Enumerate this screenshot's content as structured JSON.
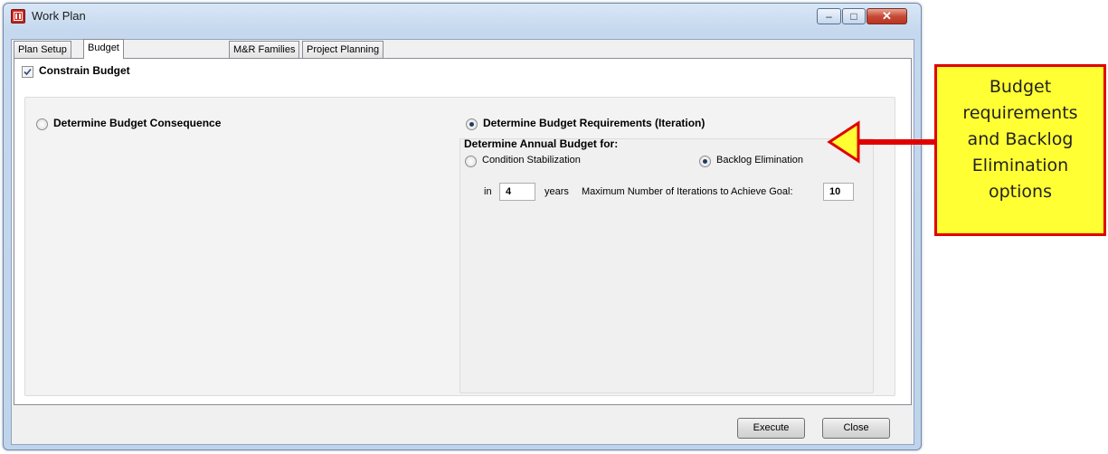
{
  "window": {
    "title": "Work Plan",
    "controls": {
      "minimize": "–",
      "maximize": "□",
      "close": "✕"
    }
  },
  "tabs": [
    {
      "label": "Plan Setup"
    },
    {
      "label": "Budget",
      "active": true
    },
    {
      "label": "M&R Families"
    },
    {
      "label": "Project Planning"
    }
  ],
  "budget": {
    "constrain_label": "Constrain Budget",
    "constrain_checked": true,
    "consequence_label": "Determine Budget Consequence",
    "requirements_label": "Determine Budget Requirements (Iteration)",
    "selected_mode": "requirements",
    "annual_group_label": "Determine Annual Budget for:",
    "condition_label": "Condition Stabilization",
    "backlog_label": "Backlog Elimination",
    "selected_target": "backlog",
    "in_label": "in",
    "years_value": "4",
    "years_label": "years",
    "iterations_label": "Maximum Number of Iterations to Achieve Goal:",
    "iterations_value": "10"
  },
  "buttons": {
    "execute": "Execute",
    "close": "Close"
  },
  "callout": {
    "lines": [
      "Budget",
      "requirements",
      "and Backlog",
      "Elimination",
      "options"
    ],
    "fill_color": "#ffff33",
    "border_color": "#e10000"
  }
}
